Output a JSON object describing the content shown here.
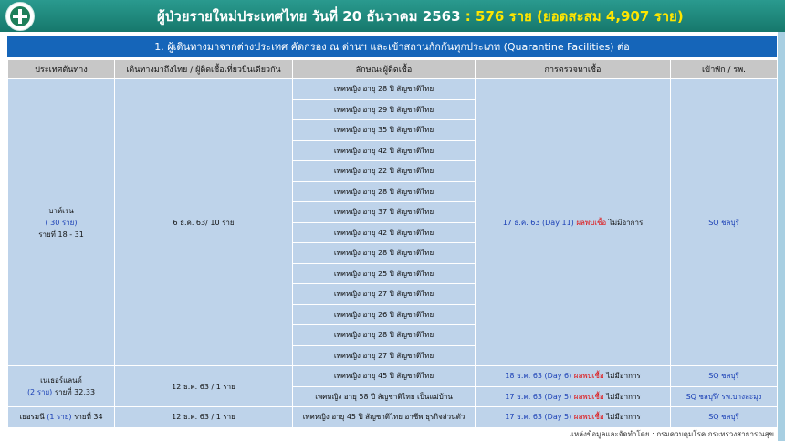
{
  "header": {
    "title_main": "ผู้ป่วยรายใหม่ประเทศไทย วันที่ 20 ธันวาคม 2563",
    "title_highlight": ": 576 ราย (ยอดสะสม 4,907 ราย)"
  },
  "subtitle": "1. ผู้เดินทางมาจากต่างประเทศ คัดกรอง ณ ด่านฯ และเข้าสถานกักกันทุกประเภท  (Quarantine Facilities) ต่อ",
  "columns": [
    "ประเทศต้นทาง",
    "เดินทางมาถึงไทย / ผู้ติดเชื้อเที่ยวบินเดียวกัน",
    "ลักษณะผู้ติดเชื้อ",
    "การตรวจหาเชื้อ",
    "เข้าพัก / รพ."
  ],
  "groups": [
    {
      "country": "บาห์เรน",
      "count": "( 30 ราย)",
      "case_range": "รายที่ 18 - 31",
      "arrival": "6 ธ.ค. 63/ 10 ราย",
      "test_date": "17 ธ.ค. 63 (Day 11)",
      "test_result": "ผลพบเชื้อ",
      "symptom": "ไม่มีอาการ",
      "facility": "SQ ชลบุรี",
      "cases": [
        "เพศหญิง อายุ 28 ปี สัญชาติไทย",
        "เพศหญิง อายุ 29 ปี สัญชาติไทย",
        "เพศหญิง อายุ 35 ปี สัญชาติไทย",
        "เพศหญิง อายุ 42 ปี สัญชาติไทย",
        "เพศหญิง อายุ 22 ปี สัญชาติไทย",
        "เพศหญิง อายุ 28 ปี สัญชาติไทย",
        "เพศหญิง อายุ 37 ปี สัญชาติไทย",
        "เพศหญิง อายุ 42 ปี สัญชาติไทย",
        "เพศหญิง อายุ 28 ปี สัญชาติไทย",
        "เพศหญิง อายุ 25 ปี สัญชาติไทย",
        "เพศหญิง อายุ 27 ปี สัญชาติไทย",
        "เพศหญิง อายุ 26 ปี สัญชาติไทย",
        "เพศหญิง อายุ 28 ปี สัญชาติไทย",
        "เพศหญิง อายุ 27 ปี สัญชาติไทย"
      ]
    },
    {
      "country": "เนเธอร์แลนด์",
      "count": "(2 ราย)",
      "case_range": "รายที่ 32,33",
      "arrival": "12 ธ.ค. 63 / 1 ราย",
      "rows": [
        {
          "case": "เพศหญิง อายุ 45 ปี สัญชาติไทย",
          "test_date": "18 ธ.ค. 63 (Day 6)",
          "test_result": "ผลพบเชื้อ",
          "symptom": "ไม่มีอาการ",
          "facility": "SQ ชลบุรี"
        },
        {
          "case": "เพศหญิง อายุ 58 ปี สัญชาติไทย เป็นแม่บ้าน",
          "test_date": "17 ธ.ค. 63 (Day 5)",
          "test_result": "ผลพบเชื้อ",
          "symptom": "ไม่มีอาการ",
          "facility": "SQ ชลบุรี/ รพ.บางละมุง"
        }
      ]
    },
    {
      "country": "เยอรมนี",
      "count": "(1 ราย)",
      "case_range": "รายที่ 34",
      "arrival": "12 ธ.ค. 63 / 1 ราย",
      "case": "เพศหญิง อายุ 45 ปี สัญชาติไทย อาชีพ ธุรกิจส่วนตัว",
      "test_date": "17 ธ.ค. 63 (Day 5)",
      "test_result": "ผลพบเชื้อ",
      "symptom": "ไม่มีอาการ",
      "facility": "SQ ชลบุรี"
    }
  ],
  "footer": "แหล่งข้อมูลและจัดทำโดย : กรมควบคุมโรค กระทรวงสาธารณสุข"
}
